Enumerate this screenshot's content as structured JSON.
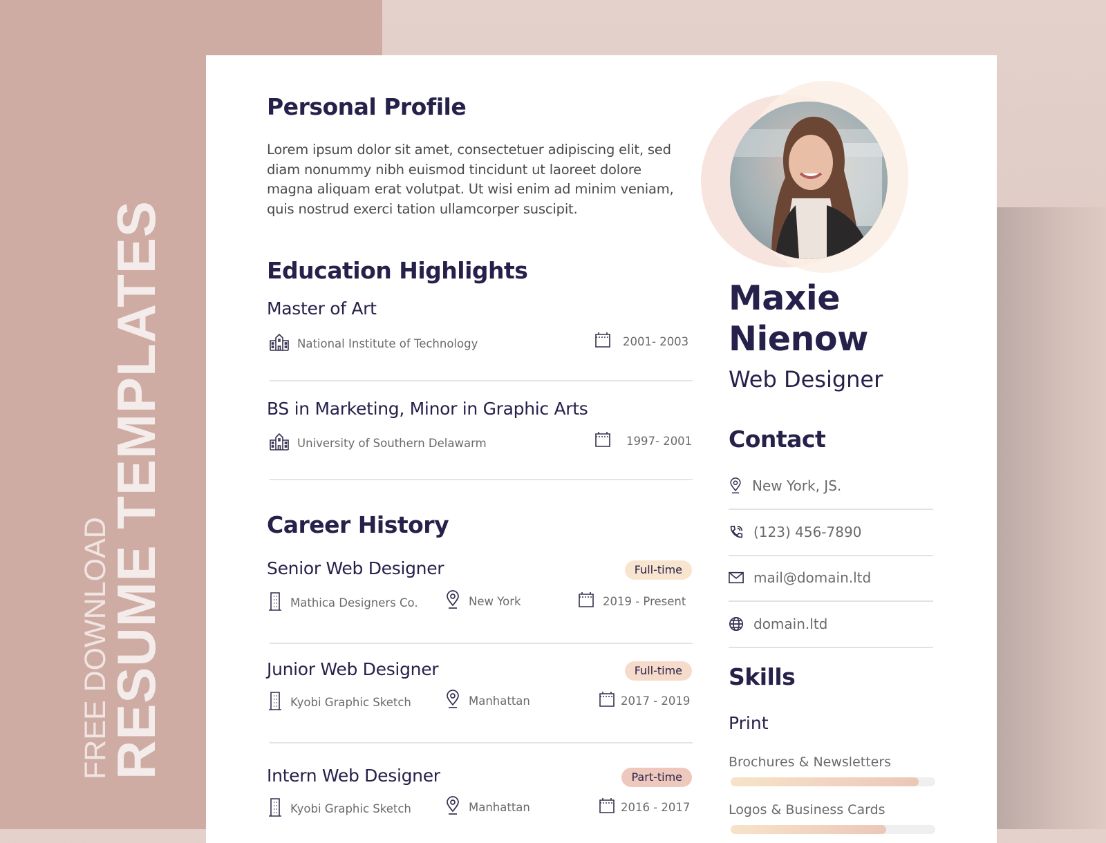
{
  "banner": {
    "line1": "FREE DOWNLOAD",
    "line2": "RESUME TEMPLATES"
  },
  "profile": {
    "heading": "Personal Profile",
    "text": "Lorem ipsum dolor sit amet, consectetuer adipiscing elit, sed diam nonummy nibh euismod tincidunt ut laoreet dolore magna aliquam erat volutpat. Ut wisi enim ad minim veniam, quis nostrud exerci tation ullamcorper suscipit."
  },
  "education": {
    "heading": "Education Highlights",
    "items": [
      {
        "degree": "Master of Art",
        "school": "National Institute of Technology",
        "years": "2001- 2003"
      },
      {
        "degree": "BS in Marketing, Minor in Graphic Arts",
        "school": "University of Southern Delawarm",
        "years": "1997- 2001"
      }
    ]
  },
  "career": {
    "heading": "Career History",
    "items": [
      {
        "role": "Senior Web Designer",
        "type": "Full-time",
        "company": "Mathica Designers Co.",
        "location": "New York",
        "years": "2019 - Present"
      },
      {
        "role": "Junior Web Designer",
        "type": "Full-time",
        "company": "Kyobi Graphic Sketch",
        "location": "Manhattan",
        "years": "2017 - 2019"
      },
      {
        "role": "Intern Web Designer",
        "type": "Part-time",
        "company": "Kyobi Graphic Sketch",
        "location": "Manhattan",
        "years": "2016 - 2017"
      }
    ]
  },
  "person": {
    "first_name": "Maxie",
    "last_name": "Nienow",
    "title": "Web Designer"
  },
  "contact": {
    "heading": "Contact",
    "items": [
      {
        "icon": "map-pin-icon",
        "value": "New York, JS."
      },
      {
        "icon": "phone-icon",
        "value": "(123) 456-7890"
      },
      {
        "icon": "mail-icon",
        "value": "mail@domain.ltd"
      },
      {
        "icon": "globe-icon",
        "value": "domain.ltd"
      }
    ]
  },
  "skills": {
    "heading": "Skills",
    "group": "Print",
    "items": [
      {
        "label": "Brochures & Newsletters",
        "level_percent": 92
      },
      {
        "label": "Logos & Business Cards",
        "level_percent": 76
      }
    ]
  },
  "colors": {
    "accent_dark": "#26214a",
    "background_pink": "#cfaca3",
    "badge_full_time": "#f8e5cf",
    "badge_part_time": "#efc8bd"
  }
}
